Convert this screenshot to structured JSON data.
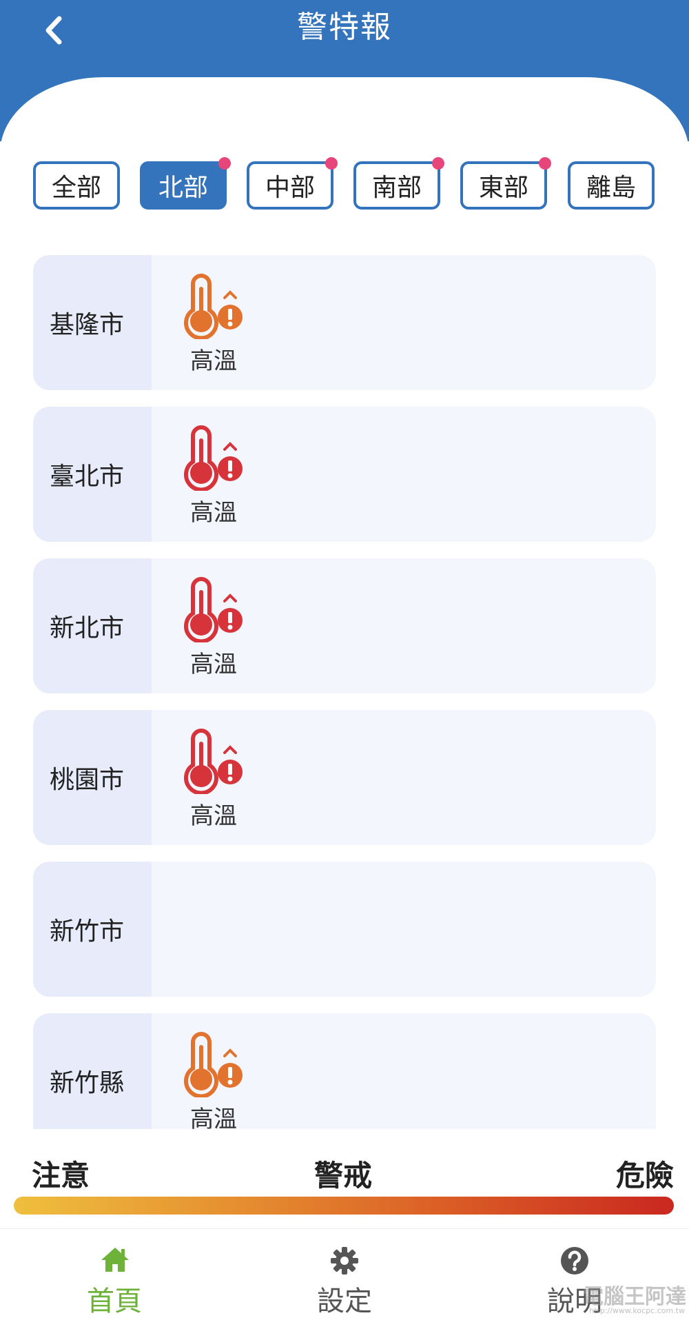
{
  "header": {
    "title": "警特報",
    "back_icon": "chevron-left-icon"
  },
  "tabs": [
    {
      "label": "全部",
      "active": false,
      "has_badge": false
    },
    {
      "label": "北部",
      "active": true,
      "has_badge": true
    },
    {
      "label": "中部",
      "active": false,
      "has_badge": true
    },
    {
      "label": "南部",
      "active": false,
      "has_badge": true
    },
    {
      "label": "東部",
      "active": false,
      "has_badge": true
    },
    {
      "label": "離島",
      "active": false,
      "has_badge": false
    }
  ],
  "rows": [
    {
      "city": "基隆市",
      "alerts": [
        {
          "label": "高溫",
          "level": "orange",
          "icon": "thermometer-icon"
        }
      ]
    },
    {
      "city": "臺北市",
      "alerts": [
        {
          "label": "高溫",
          "level": "red",
          "icon": "thermometer-icon"
        }
      ]
    },
    {
      "city": "新北市",
      "alerts": [
        {
          "label": "高溫",
          "level": "red",
          "icon": "thermometer-icon"
        }
      ]
    },
    {
      "city": "桃園市",
      "alerts": [
        {
          "label": "高溫",
          "level": "red",
          "icon": "thermometer-icon"
        }
      ]
    },
    {
      "city": "新竹市",
      "alerts": []
    },
    {
      "city": "新竹縣",
      "alerts": [
        {
          "label": "高溫",
          "level": "orange",
          "icon": "thermometer-icon"
        }
      ]
    }
  ],
  "legend": {
    "low": "注意",
    "mid": "警戒",
    "high": "危險"
  },
  "bottom_nav": [
    {
      "label": "首頁",
      "icon": "home-icon",
      "active": true
    },
    {
      "label": "設定",
      "icon": "gear-icon",
      "active": false
    },
    {
      "label": "說明",
      "icon": "help-icon",
      "active": false
    }
  ],
  "watermark": {
    "text": "電腦王阿達",
    "url": "http://www.kocpc.com.tw"
  },
  "colors": {
    "primary": "#3474bc",
    "badge": "#e8457a",
    "alert_orange": "#e2732e",
    "alert_red": "#d6333a",
    "nav_active": "#6fb23a",
    "nav_inactive": "#555555"
  }
}
